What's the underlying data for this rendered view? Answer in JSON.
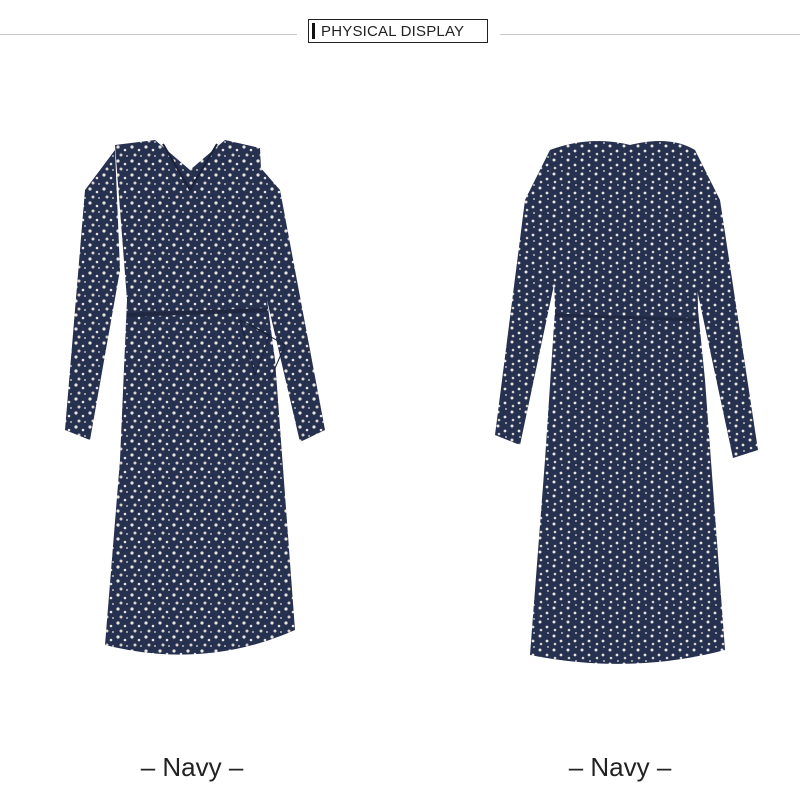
{
  "header": {
    "badge_label": "PHYSICAL DISPLAY"
  },
  "products": [
    {
      "view": "front",
      "caption": "– Navy –"
    },
    {
      "view": "back",
      "caption": "– Navy –"
    }
  ],
  "colors": {
    "dress_base": "#26304f",
    "floral_print": "#e8e4e0",
    "rule": "#c8c8c8"
  }
}
